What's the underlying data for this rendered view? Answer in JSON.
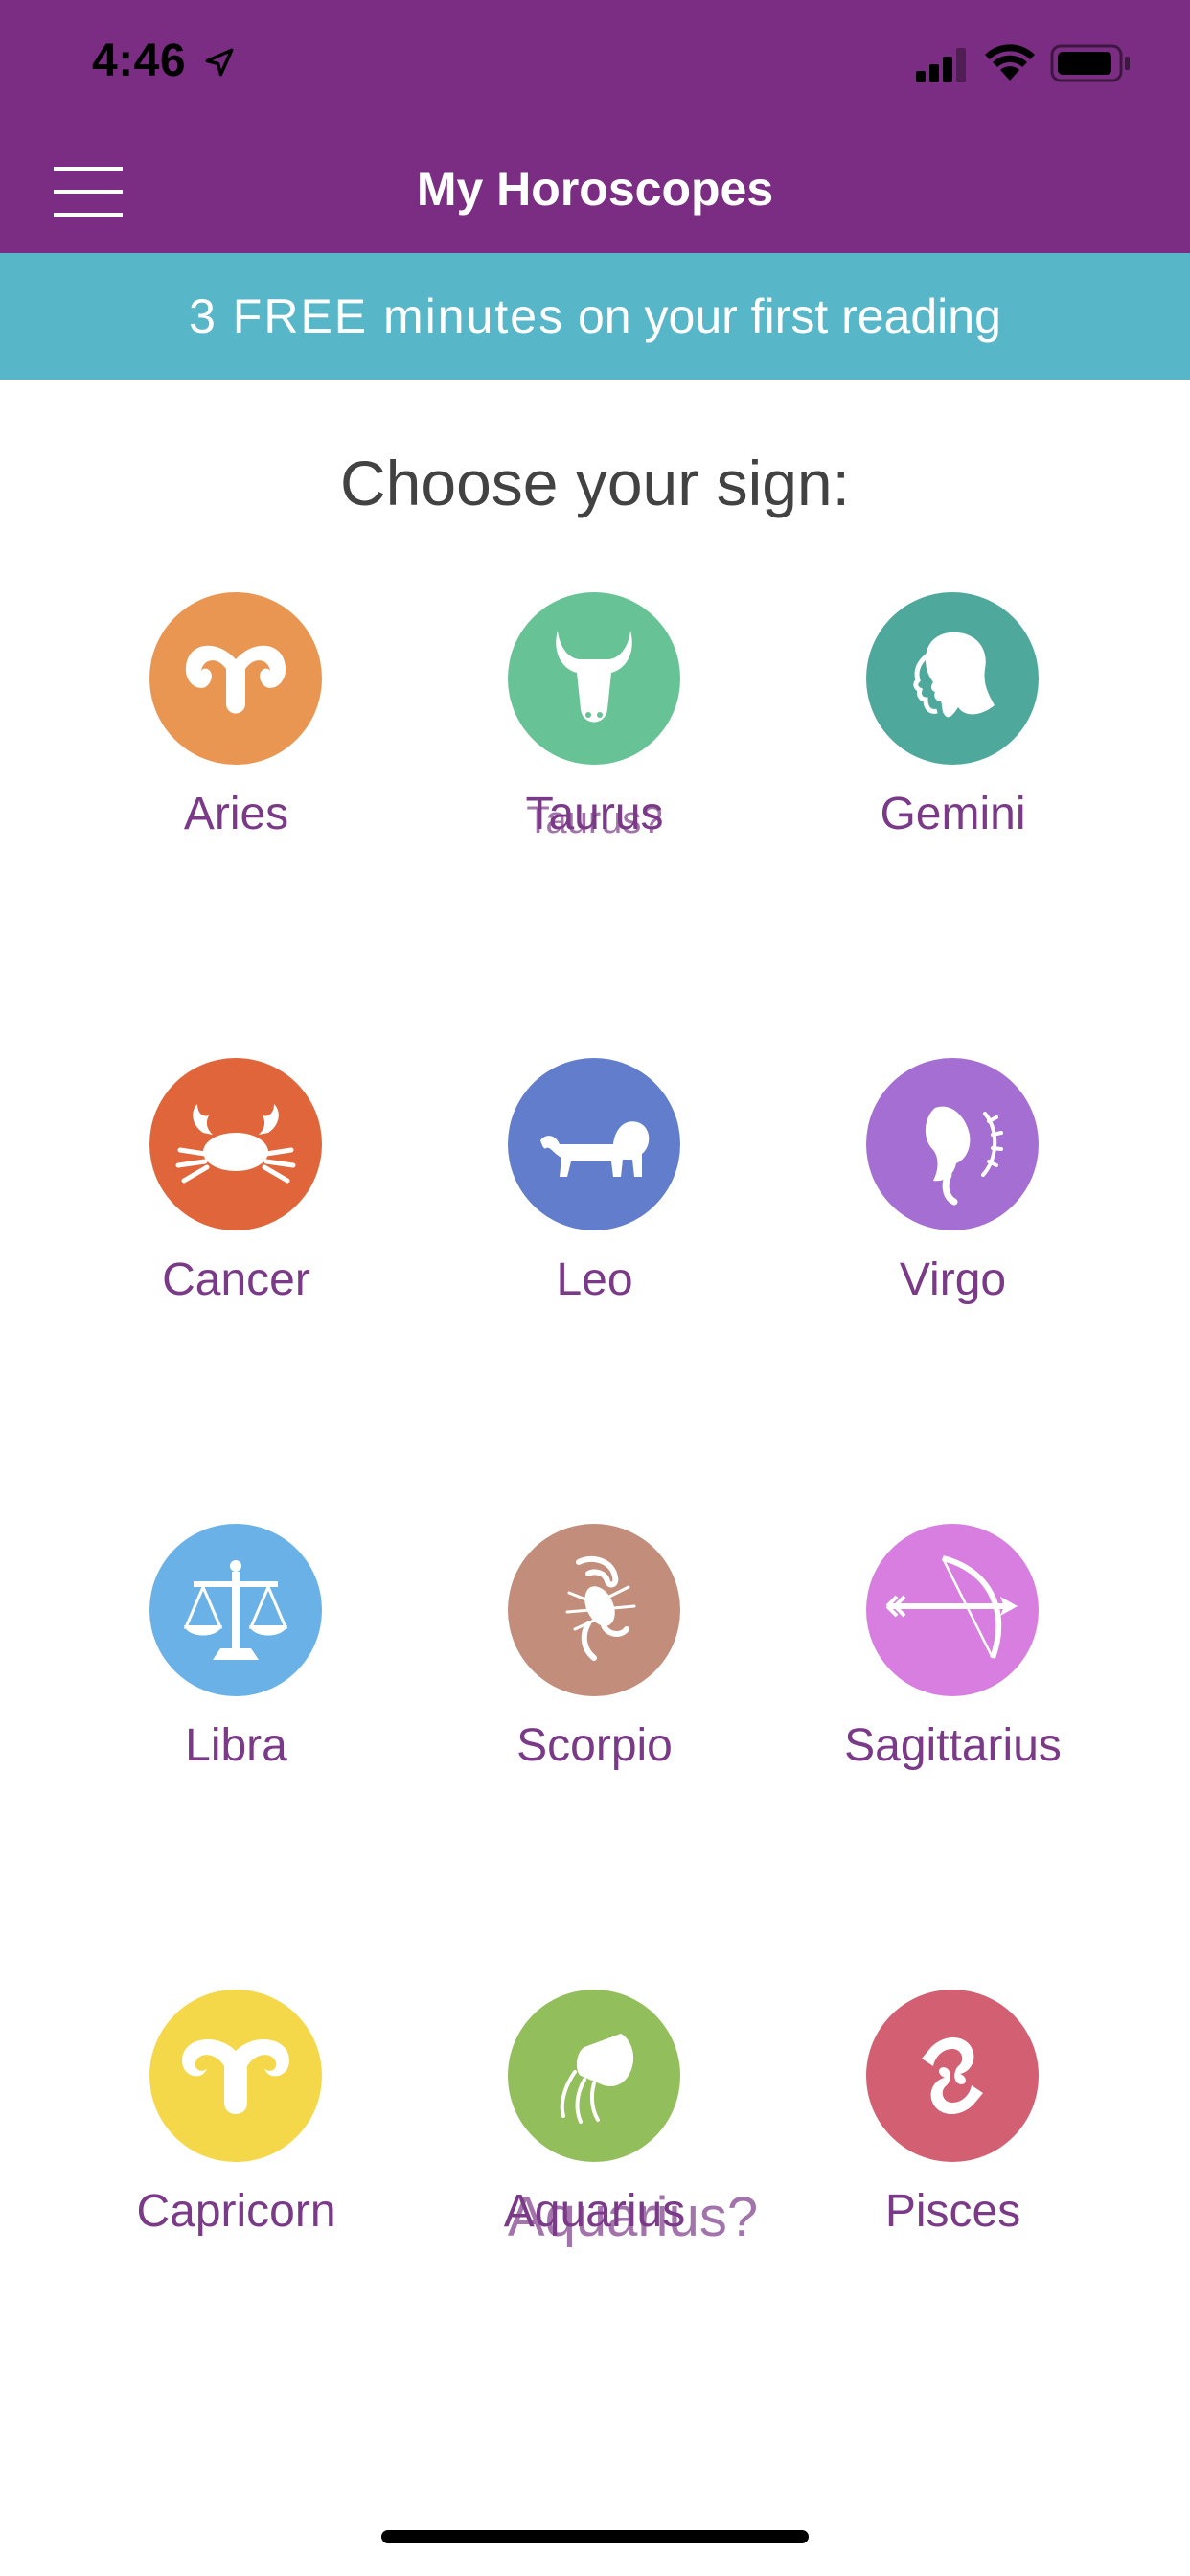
{
  "status_bar": {
    "time": "4:46",
    "location_icon": "location-arrow-icon",
    "signal_icon": "cellular-signal-icon",
    "wifi_icon": "wifi-icon",
    "battery_icon": "battery-icon"
  },
  "header": {
    "title": "My Horoscopes",
    "menu_icon": "hamburger-menu-icon",
    "background": "#7b2d83"
  },
  "promo": {
    "highlight": "3 FREE minutes",
    "text": " on your first reading",
    "background": "#57b6c8"
  },
  "heading": "Choose your sign:",
  "signs": [
    {
      "label": "Aries",
      "color": "#ea9653",
      "icon": "ram-icon"
    },
    {
      "label": "Taurus",
      "ghost": "Taurus?",
      "color": "#67c295",
      "icon": "bull-icon"
    },
    {
      "label": "Gemini",
      "color": "#4fa89c",
      "icon": "twins-icon"
    },
    {
      "label": "Cancer",
      "color": "#e0653a",
      "icon": "crab-icon"
    },
    {
      "label": "Leo",
      "color": "#627dcb",
      "icon": "lion-icon"
    },
    {
      "label": "Virgo",
      "color": "#a56ed2",
      "icon": "maiden-icon"
    },
    {
      "label": "Libra",
      "color": "#69b1e6",
      "icon": "scales-icon"
    },
    {
      "label": "Scorpio",
      "color": "#c28d7b",
      "icon": "scorpion-icon"
    },
    {
      "label": "Sagittarius",
      "color": "#d77ee0",
      "icon": "bow-arrow-icon"
    },
    {
      "label": "Capricorn",
      "color": "#f5d84a",
      "icon": "goat-icon"
    },
    {
      "label": "Aquarius",
      "ghost": "Aquarius?",
      "color": "#93be5c",
      "icon": "water-bearer-icon"
    },
    {
      "label": "Pisces",
      "color": "#d35f72",
      "icon": "fish-icon"
    }
  ]
}
